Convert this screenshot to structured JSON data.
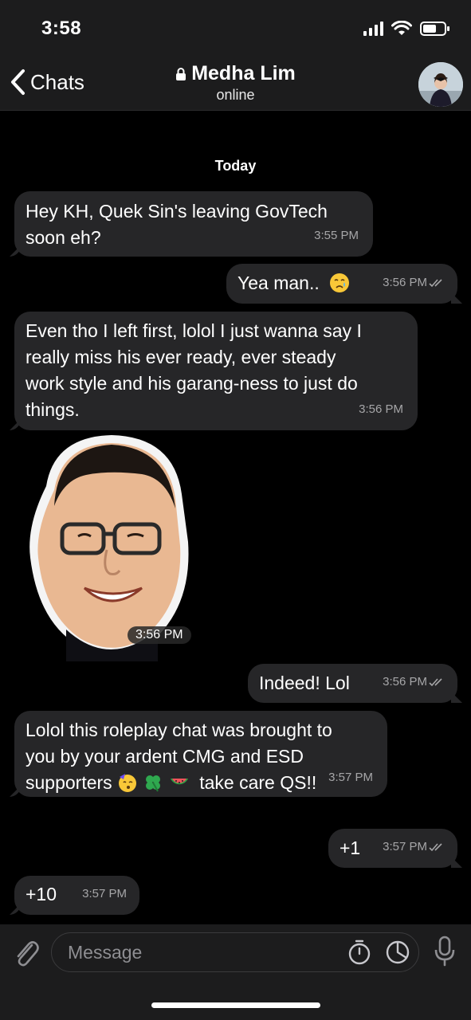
{
  "status_bar": {
    "time": "3:58"
  },
  "header": {
    "back_label": "Chats",
    "contact_name": "Medha Lim",
    "contact_status": "online"
  },
  "chat": {
    "date_separator": "Today",
    "messages": [
      {
        "direction": "in",
        "text_lines": [
          "Hey KH, Quek Sin's leaving GovTech",
          "soon eh?"
        ],
        "time": "3:55 PM"
      },
      {
        "direction": "out",
        "text": "Yea man..",
        "emoji": "crying-face",
        "time": "3:56 PM"
      },
      {
        "direction": "in",
        "text_lines": [
          "Even tho I left first, lolol I just wanna say I",
          "really miss his ever ready, ever steady",
          "work style and his garang-ness to just do",
          "things."
        ],
        "time": "3:56 PM"
      },
      {
        "direction": "in",
        "type": "sticker",
        "time": "3:56 PM"
      },
      {
        "direction": "out",
        "text": "Indeed! Lol",
        "time": "3:56 PM"
      },
      {
        "direction": "in",
        "text_lines": [
          "Lolol this roleplay chat was brought to",
          "you by your ardent CMG and ESD",
          "supporters",
          "take care QS!!"
        ],
        "emojis": [
          "partying-face",
          "four-leaf-clover",
          "watermelon"
        ],
        "time": "3:57 PM"
      },
      {
        "direction": "out",
        "text": "+1",
        "time": "3:57 PM"
      },
      {
        "direction": "in",
        "text": "+10",
        "time": "3:57 PM"
      }
    ]
  },
  "input": {
    "placeholder": "Message"
  },
  "colors": {
    "bubble": "#262628",
    "bar": "#1c1c1d",
    "timestamp": "#a6a6a8"
  }
}
